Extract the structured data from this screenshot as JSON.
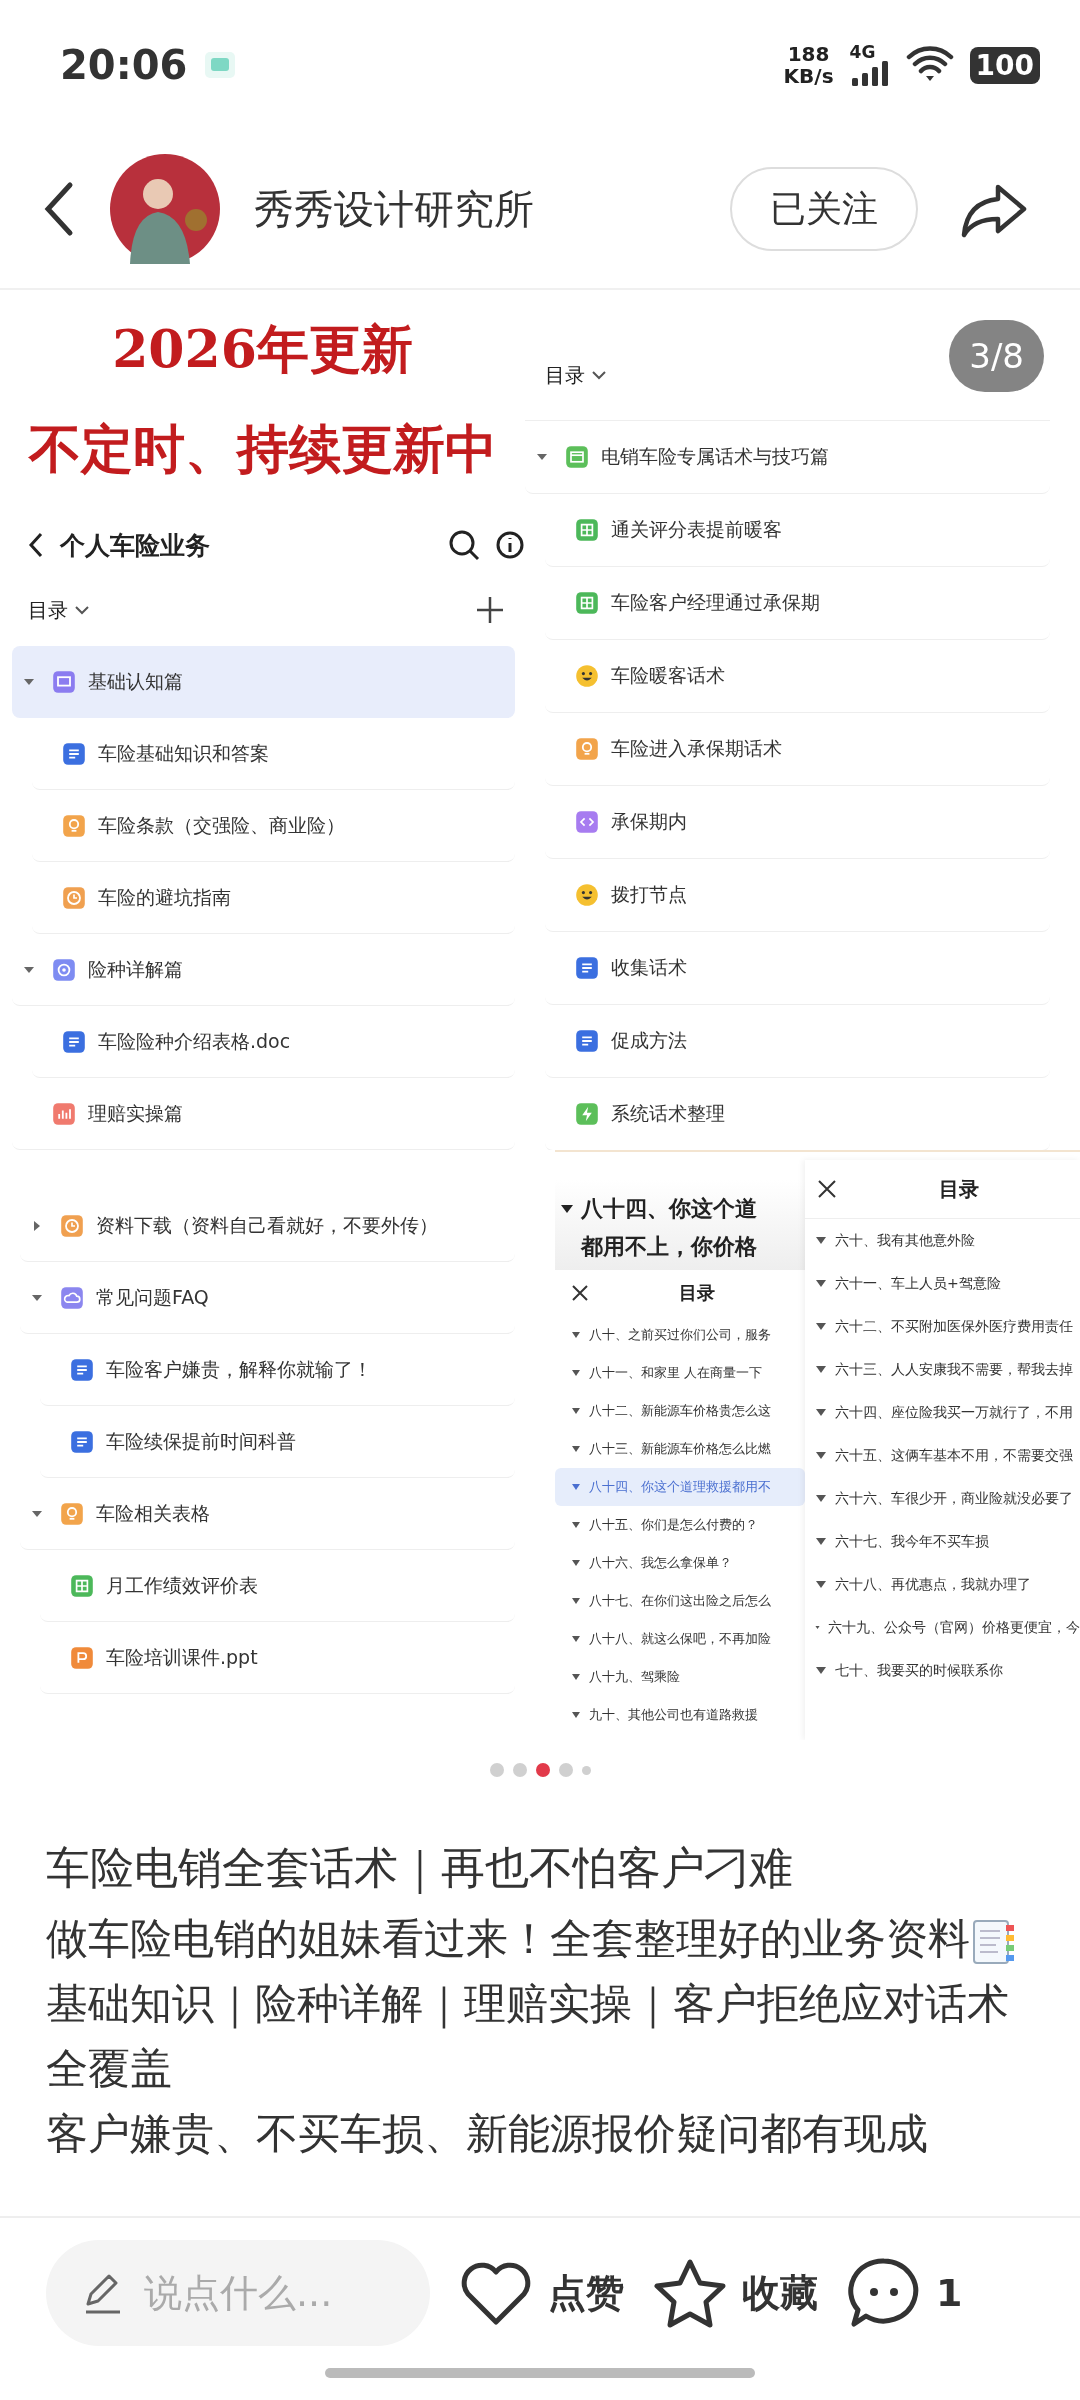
{
  "status_bar": {
    "time": "20:06",
    "net_speed": "188",
    "net_unit": "KB/s",
    "network": "4G",
    "battery": "100"
  },
  "header": {
    "author": "秀秀设计研究所",
    "follow_button": "已关注"
  },
  "carousel": {
    "page_indicator": "3/8",
    "banner": [
      "2026年更新",
      "不定时、持续更新中"
    ],
    "doc_panel": {
      "title": "个人车险业务",
      "toc_label": "目录",
      "items": [
        {
          "label": "基础认知篇",
          "kind": "board",
          "expanded": true,
          "selected": true,
          "children": [
            {
              "label": "车险基础知识和答案",
              "kind": "doc",
              "selected": false
            },
            {
              "label": "车险条款（交强险、商业险）",
              "kind": "bulb",
              "selected": false
            },
            {
              "label": "车险的避坑指南",
              "kind": "clock",
              "selected": false
            }
          ]
        },
        {
          "label": "险种详解篇",
          "kind": "gear",
          "expanded": true,
          "selected": false,
          "children": [
            {
              "label": "车险险种介绍表格.doc",
              "kind": "word",
              "selected": false
            }
          ]
        },
        {
          "label": "理赔实操篇",
          "kind": "chart",
          "selected": false
        }
      ]
    },
    "toc_panel": {
      "toc_label": "目录",
      "items": [
        {
          "label": "电销车险专属话术与技巧篇",
          "kind": "calendar",
          "expanded": true,
          "selected": false,
          "children": [
            {
              "label": "通关评分表提前暖客",
              "kind": "sheet",
              "selected": false
            },
            {
              "label": "车险客户经理通过承保期",
              "kind": "sheet",
              "selected": false
            },
            {
              "label": "车险暖客话术",
              "kind": "smile",
              "selected": false
            },
            {
              "label": "车险进入承保期话术",
              "kind": "bulb",
              "selected": false
            },
            {
              "label": "承保期内",
              "kind": "code",
              "selected": false
            },
            {
              "label": "拨打节点",
              "kind": "smile",
              "selected": false
            },
            {
              "label": "收集话术",
              "kind": "doc",
              "selected": false
            },
            {
              "label": "促成方法",
              "kind": "doc",
              "selected": false
            },
            {
              "label": "系统话术整理",
              "kind": "bolt",
              "selected": false
            }
          ]
        }
      ]
    },
    "faq_panel": {
      "items": [
        {
          "label": "资料下载（资料自己看就好，不要外传）",
          "kind": "clock",
          "expanded": false,
          "selected": false
        },
        {
          "label": "常见问题FAQ",
          "kind": "cloud",
          "expanded": true,
          "selected": false,
          "children": [
            {
              "label": "车险客户嫌贵，解释你就输了！",
              "kind": "doc",
              "selected": false
            },
            {
              "label": "车险续保提前时间科普",
              "kind": "doc",
              "selected": false
            }
          ]
        },
        {
          "label": "车险相关表格",
          "kind": "bulb",
          "expanded": true,
          "selected": false,
          "children": [
            {
              "label": "月工作绩效评价表",
              "kind": "sheet",
              "selected": false
            },
            {
              "label": "车险培训课件.ppt",
              "kind": "ppt",
              "selected": false
            }
          ]
        }
      ]
    },
    "outline_a": {
      "heading_lines": [
        "八十四、你这个道",
        "都用不上，你价格"
      ],
      "dialog_title": "目录",
      "entries": [
        {
          "label": "八十、之前买过你们公司，服务",
          "selected": false
        },
        {
          "label": "八十一、和家里 人在商量一下",
          "selected": false
        },
        {
          "label": "八十二、新能源车价格贵怎么这",
          "selected": false
        },
        {
          "label": "八十三、新能源车价格怎么比燃",
          "selected": false
        },
        {
          "label": "八十四、你这个道理救援都用不",
          "selected": true
        },
        {
          "label": "八十五、你们是怎么付费的？",
          "selected": false
        },
        {
          "label": "八十六、我怎么拿保单？",
          "selected": false
        },
        {
          "label": "八十七、在你们这出险之后怎么",
          "selected": false
        },
        {
          "label": "八十八、就这么保吧，不再加险",
          "selected": false
        },
        {
          "label": "八十九、驾乘险",
          "selected": false
        },
        {
          "label": "九十、其他公司也有道路救援",
          "selected": false
        }
      ]
    },
    "outline_b": {
      "dialog_title": "目录",
      "entries": [
        {
          "label": "六十、我有其他意外险",
          "selected": false
        },
        {
          "label": "六十一、车上人员+驾意险",
          "selected": false
        },
        {
          "label": "六十二、不买附加医保外医疗费用责任",
          "selected": false
        },
        {
          "label": "六十三、人人安康我不需要，帮我去掉",
          "selected": false
        },
        {
          "label": "六十四、座位险我买一万就行了，不用",
          "selected": false
        },
        {
          "label": "六十五、这俩车基本不用，不需要交强",
          "selected": false
        },
        {
          "label": "六十六、车很少开，商业险就没必要了",
          "selected": false
        },
        {
          "label": "六十七、我今年不买车损",
          "selected": false
        },
        {
          "label": "六十八、再优惠点，我就办理了",
          "selected": false
        },
        {
          "label": "六十九、公众号（官网）价格更便宜，今",
          "selected": false
        },
        {
          "label": "七十、我要买的时候联系你",
          "selected": false
        }
      ]
    },
    "dots": [
      {
        "selected": false
      },
      {
        "selected": false
      },
      {
        "selected": true
      },
      {
        "selected": false
      },
      {
        "selected": false
      }
    ]
  },
  "post": {
    "title": "车险电销全套话术｜再也不怕客户刁难",
    "paragraphs": [
      "做车险电销的姐妹看过来！全套整理好的业务资料",
      "基础知识｜险种详解｜理赔实操｜客户拒绝应对话术全覆盖",
      "客户嫌贵、不买车损、新能源报价疑问都有现成"
    ]
  },
  "bottom_bar": {
    "comment_placeholder": "说点什么...",
    "like": "点赞",
    "collect": "收藏",
    "comment_count": "1"
  }
}
